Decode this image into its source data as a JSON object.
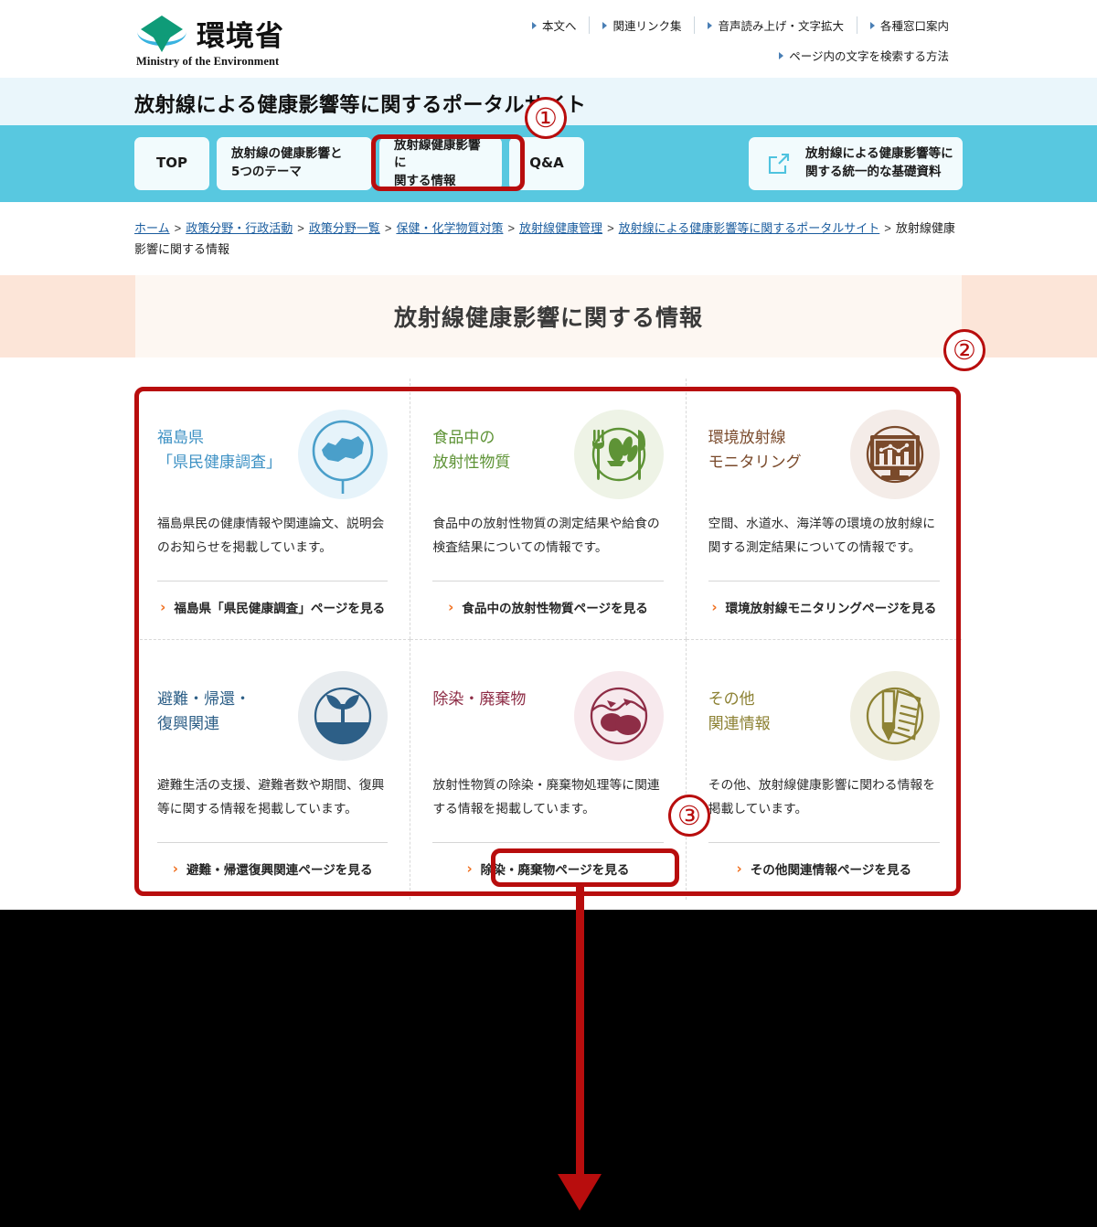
{
  "header": {
    "logo_jp": "環境省",
    "logo_en": "Ministry of the Environment",
    "util_links_row1": [
      {
        "label": "本文へ",
        "icon": "triangle-right-icon"
      },
      {
        "label": "関連リンク集",
        "icon": "triangle-right-icon"
      },
      {
        "label": "音声読み上げ・文字拡大",
        "icon": "triangle-right-icon"
      },
      {
        "label": "各種窓口案内",
        "icon": "triangle-right-icon"
      }
    ],
    "util_links_row2": [
      {
        "label": "ページ内の文字を検索する方法",
        "icon": "triangle-right-icon"
      }
    ]
  },
  "portal": {
    "title": "放射線による健康影響等に関するポータルサイト",
    "band_color": "#eaf6fb"
  },
  "nav": {
    "bar_color": "#58c8e0",
    "tabs": [
      {
        "id": "top",
        "lines": [
          "TOP"
        ]
      },
      {
        "id": "themes",
        "lines": [
          "放射線の健康影響と",
          "5つのテーマ"
        ]
      },
      {
        "id": "info",
        "lines": [
          "放射線健康影響に",
          "関する情報"
        ],
        "active": true
      },
      {
        "id": "qa",
        "lines": [
          "Q&A"
        ]
      }
    ],
    "external_button": {
      "icon": "external-link-icon",
      "lines": [
        "放射線による健康影響等に",
        "関する統一的な基礎資料"
      ]
    }
  },
  "breadcrumb": {
    "items": [
      {
        "label": "ホーム",
        "link": true
      },
      {
        "label": "政策分野・行政活動",
        "link": true
      },
      {
        "label": "政策分野一覧",
        "link": true
      },
      {
        "label": "保健・化学物質対策",
        "link": true
      },
      {
        "label": "放射線健康管理",
        "link": true
      },
      {
        "label": "放射線による健康影響等に関するポータルサイト",
        "link": true
      },
      {
        "label": "放射線健康影響に関する情報",
        "link": false
      }
    ],
    "separator": ">"
  },
  "page": {
    "title": "放射線健康影響に関する情報",
    "band_outer_color": "#fce5d8",
    "band_inner_color": "#fdf7f2"
  },
  "cards": [
    {
      "theme": "c-blue",
      "title_lines": [
        "福島県",
        "「県民健康調査」"
      ],
      "description": "福島県民の健康情報や関連論文、説明会のお知らせを掲載しています。",
      "link_label": "福島県「県民健康調査」ページを見る",
      "icon": "fukushima-map-pin-icon",
      "accent": "#3d91c4"
    },
    {
      "theme": "c-green",
      "title_lines": [
        "食品中の",
        "放射性物質"
      ],
      "description": "食品中の放射性物質の測定結果や給食の検査結果についての情報です。",
      "link_label": "食品中の放射性物質ページを見る",
      "icon": "food-plate-cutlery-icon",
      "accent": "#5e9336"
    },
    {
      "theme": "c-brown",
      "title_lines": [
        "環境放射線",
        "モニタリング"
      ],
      "description": "空間、水道水、海洋等の環境の放射線に関する測定結果についての情報です。",
      "link_label": "環境放射線モニタリングページを見る",
      "icon": "monitoring-chart-board-icon",
      "accent": "#7a4a2b"
    },
    {
      "theme": "c-navy",
      "title_lines": [
        "避難・帰還・",
        "復興関連"
      ],
      "description": "避難生活の支援、避難者数や期間、復興等に関する情報を掲載しています。",
      "link_label": "避難・帰還復興関連ページを見る",
      "icon": "sprout-plant-icon",
      "accent": "#2d5f87"
    },
    {
      "theme": "c-maroon",
      "title_lines": [
        "除染・廃棄物"
      ],
      "description": "放射性物質の除染・廃棄物処理等に関連する情報を掲載しています。",
      "link_label": "除染・廃棄物ページを見る",
      "icon": "waste-bags-icon",
      "accent": "#8e2d46"
    },
    {
      "theme": "c-olive",
      "title_lines": [
        "その他",
        "関連情報"
      ],
      "description": "その他、放射線健康影響に関わる情報を掲載しています。",
      "link_label": "その他関連情報ページを見る",
      "icon": "pen-document-icon",
      "accent": "#8d8234"
    }
  ],
  "annotations": {
    "color": "#b80d0d",
    "markers": [
      {
        "id": "1",
        "label": "①",
        "target": "nav-tab-info"
      },
      {
        "id": "2",
        "label": "②",
        "target": "card-grid"
      },
      {
        "id": "3",
        "label": "③",
        "target": "card-link-decontamination"
      }
    ],
    "arrow": {
      "from": "card-link-decontamination",
      "direction": "down"
    }
  },
  "chevron": "›"
}
